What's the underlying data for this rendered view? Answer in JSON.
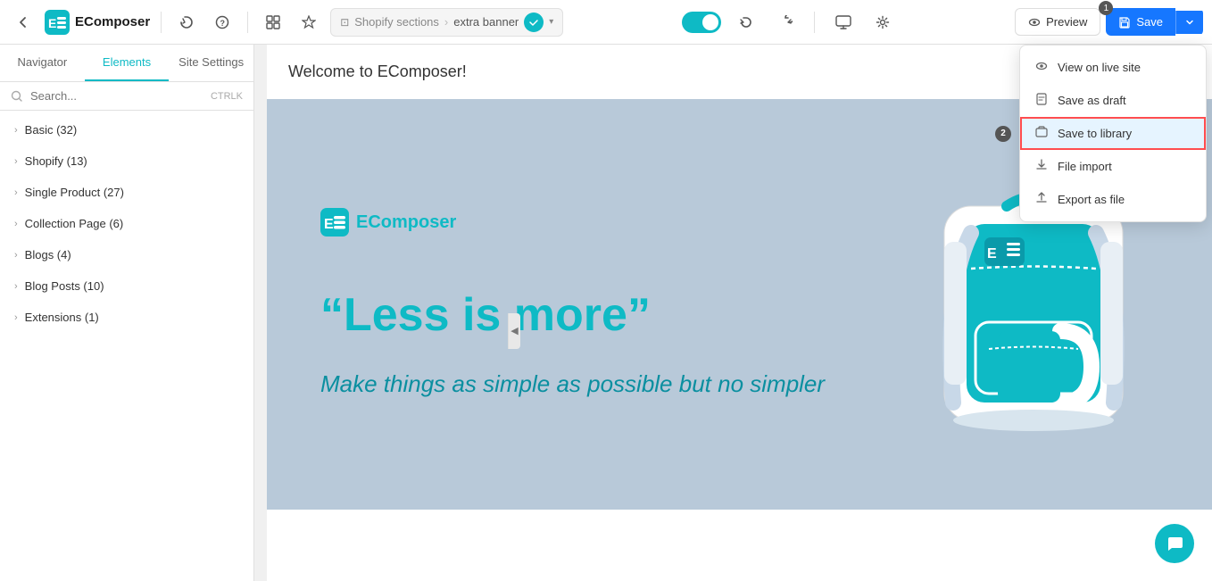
{
  "app": {
    "name": "EComposer"
  },
  "toolbar": {
    "back_icon": "←",
    "history_icon": "⟳",
    "help_icon": "?",
    "layout_icon": "⊞",
    "element_icon": "✦",
    "breadcrumb": {
      "section_label": "Shopify sections",
      "separator": "›",
      "page_name": "extra banner"
    },
    "undo_icon": "↺",
    "redo_icon": "↻",
    "desktop_icon": "🖥",
    "settings_icon": "⚙",
    "preview_label": "Preview",
    "save_label": "Save",
    "badge1": "1",
    "badge2": "2"
  },
  "left_panel": {
    "tabs": [
      {
        "id": "navigator",
        "label": "Navigator"
      },
      {
        "id": "elements",
        "label": "Elements"
      },
      {
        "id": "site-settings",
        "label": "Site Settings"
      }
    ],
    "search_placeholder": "Search...",
    "search_hint": "CTRLK",
    "items": [
      {
        "label": "Basic",
        "count": 32
      },
      {
        "label": "Shopify",
        "count": 13
      },
      {
        "label": "Single Product",
        "count": 27
      },
      {
        "label": "Collection Page",
        "count": 6
      },
      {
        "label": "Blogs",
        "count": 4
      },
      {
        "label": "Blog Posts",
        "count": 10
      },
      {
        "label": "Extensions",
        "count": 1
      }
    ]
  },
  "canvas": {
    "welcome_text": "Welcome to EComposer!",
    "banner": {
      "logo_text": "EComposer",
      "heading": "“Less is more”",
      "subtext": "Make things as simple as possible but no simpler"
    }
  },
  "dropdown": {
    "items": [
      {
        "id": "view-live",
        "icon": "👁",
        "label": "View on live site"
      },
      {
        "id": "save-draft",
        "icon": "📄",
        "label": "Save as draft"
      },
      {
        "id": "save-library",
        "icon": "🗂",
        "label": "Save to library",
        "highlighted": true
      },
      {
        "id": "file-import",
        "icon": "↑",
        "label": "File import"
      },
      {
        "id": "export-file",
        "icon": "↓",
        "label": "Export as file"
      }
    ]
  },
  "callout": {
    "badge1": "1",
    "badge2": "2"
  },
  "colors": {
    "primary": "#0ebac5",
    "save_btn": "#1677ff",
    "banner_bg": "#b8c8d8",
    "highlight_border": "#ff4d4f"
  }
}
